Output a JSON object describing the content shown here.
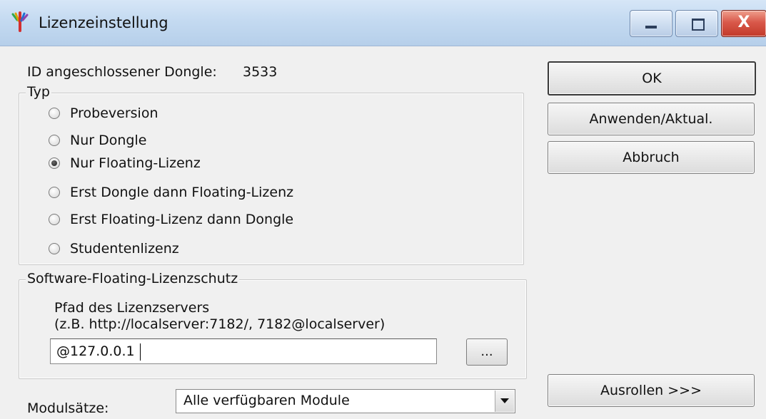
{
  "window": {
    "title": "Lizenzeinstellung",
    "close_glyph": "X",
    "app_icon": "colored-sticks-app-icon"
  },
  "dongle": {
    "label": "ID angeschlossener Dongle:",
    "value": "3533"
  },
  "typ": {
    "legend": "Typ",
    "options": [
      {
        "label": "Probeversion",
        "checked": false
      },
      {
        "label": "Nur Dongle",
        "checked": false
      },
      {
        "label": "Nur Floating-Lizenz",
        "checked": true
      },
      {
        "label": "Erst Dongle dann Floating-Lizenz",
        "checked": false
      },
      {
        "label": "Erst Floating-Lizenz dann Dongle",
        "checked": false
      },
      {
        "label": "Studentenlizenz",
        "checked": false
      }
    ]
  },
  "software_floating": {
    "legend": "Software-Floating-Lizenzschutz",
    "path_label": "Pfad des Lizenzservers",
    "path_hint": "(z.B. http://localserver:7182/, 7182@localserver)",
    "path_value": "@127.0.0.1",
    "browse_label": "..."
  },
  "modules": {
    "label": "Modulsätze:",
    "selected": "Alle verfügbaren Module"
  },
  "buttons": {
    "ok": "OK",
    "apply": "Anwenden/Aktual.",
    "cancel": "Abbruch",
    "expand": "Ausrollen >>>"
  }
}
